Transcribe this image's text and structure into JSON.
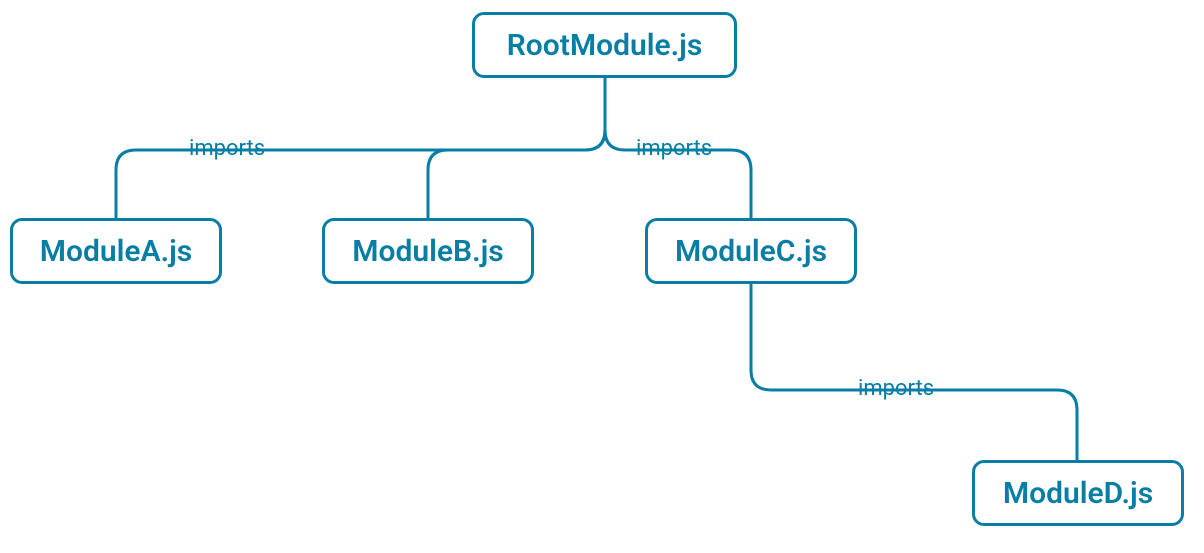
{
  "nodes": {
    "root": {
      "label": "RootModule.js"
    },
    "a": {
      "label": "ModuleA.js"
    },
    "b": {
      "label": "ModuleB.js"
    },
    "c": {
      "label": "ModuleC.js"
    },
    "d": {
      "label": "ModuleD.js"
    }
  },
  "edgeLabels": {
    "rootLeft": "imports",
    "rootRight": "imports",
    "cToD": "imports"
  },
  "colors": {
    "stroke": "#087ea4",
    "text": "#087ea4",
    "nodeBg": "#ffffff"
  }
}
